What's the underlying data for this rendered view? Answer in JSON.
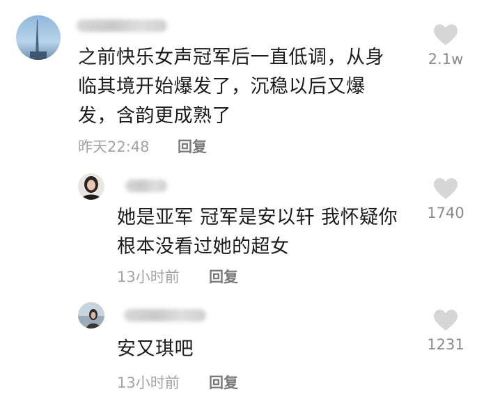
{
  "comments": [
    {
      "text": "之前快乐女声冠军后一直低调，从身临其境开始爆发了，沉稳以后又爆发，含韵更成熟了",
      "time": "昨天22:48",
      "reply_label": "回复",
      "likes": "2.1w",
      "like_icon": "heart-icon",
      "avatar": "tower-avatar"
    }
  ],
  "replies": [
    {
      "text": "她是亚军 冠军是安以轩 我怀疑你根本没看过她的超女",
      "time": "13小时前",
      "reply_label": "回复",
      "likes": "1740",
      "like_icon": "heart-icon",
      "avatar": "woman-avatar"
    },
    {
      "text": "安又琪吧",
      "time": "13小时前",
      "reply_label": "回复",
      "likes": "1231",
      "like_icon": "heart-icon",
      "avatar": "photo-avatar"
    }
  ],
  "colors": {
    "content_text": "#1b1b1b",
    "meta_text": "#a3a3a3",
    "reply_text": "#7a7a7a",
    "like_icon": "#d6d6d6"
  }
}
